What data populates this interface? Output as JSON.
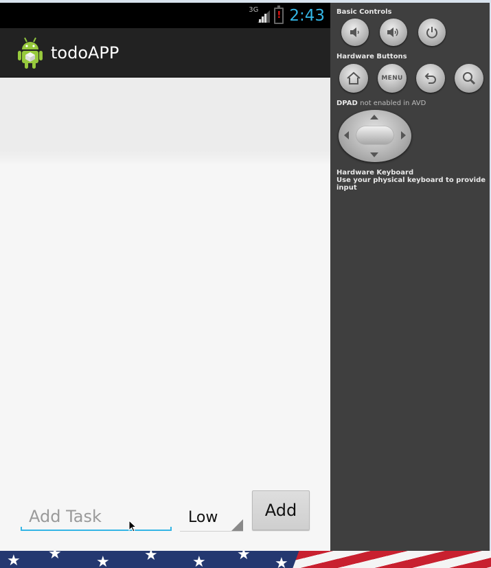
{
  "status_bar": {
    "network": "3G",
    "battery_alert": "!",
    "time": "2:43",
    "time_color": "#33b5e5"
  },
  "app": {
    "title": "todoAPP",
    "icon": "android-robot-icon"
  },
  "task_input": {
    "placeholder": "Add Task",
    "value": ""
  },
  "priority_spinner": {
    "selected": "Low"
  },
  "add_button": {
    "label": "Add"
  },
  "emulator_panel": {
    "basic_controls": {
      "title": "Basic Controls",
      "buttons": [
        "volume-down-icon",
        "volume-up-icon",
        "power-icon"
      ]
    },
    "hardware_buttons": {
      "title": "Hardware Buttons",
      "menu_label": "MENU",
      "buttons": [
        "home-icon",
        "menu-button",
        "back-icon",
        "search-icon"
      ]
    },
    "dpad": {
      "title": "DPAD",
      "note": "not enabled in AVD"
    },
    "keyboard": {
      "title": "Hardware Keyboard",
      "hint": "Use your physical keyboard to provide input"
    }
  },
  "colors": {
    "accent": "#33b5e5",
    "action_bar": "#222222",
    "panel": "#3f3f3f"
  }
}
